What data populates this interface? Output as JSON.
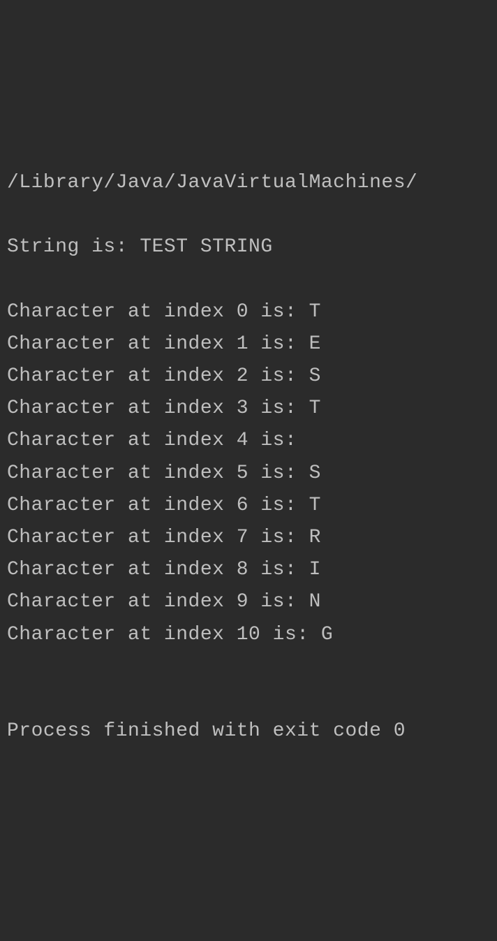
{
  "console": {
    "path_line": "/Library/Java/JavaVirtualMachines/",
    "string_line": "String is: TEST STRING",
    "chars": [
      {
        "index": 0,
        "ch": "T"
      },
      {
        "index": 1,
        "ch": "E"
      },
      {
        "index": 2,
        "ch": "S"
      },
      {
        "index": 3,
        "ch": "T"
      },
      {
        "index": 4,
        "ch": " "
      },
      {
        "index": 5,
        "ch": "S"
      },
      {
        "index": 6,
        "ch": "T"
      },
      {
        "index": 7,
        "ch": "R"
      },
      {
        "index": 8,
        "ch": "I"
      },
      {
        "index": 9,
        "ch": "N"
      },
      {
        "index": 10,
        "ch": "G"
      }
    ],
    "char_line_prefix": "Character at index ",
    "char_line_middle": " is: ",
    "blank_line": "",
    "exit_line": "Process finished with exit code 0"
  }
}
